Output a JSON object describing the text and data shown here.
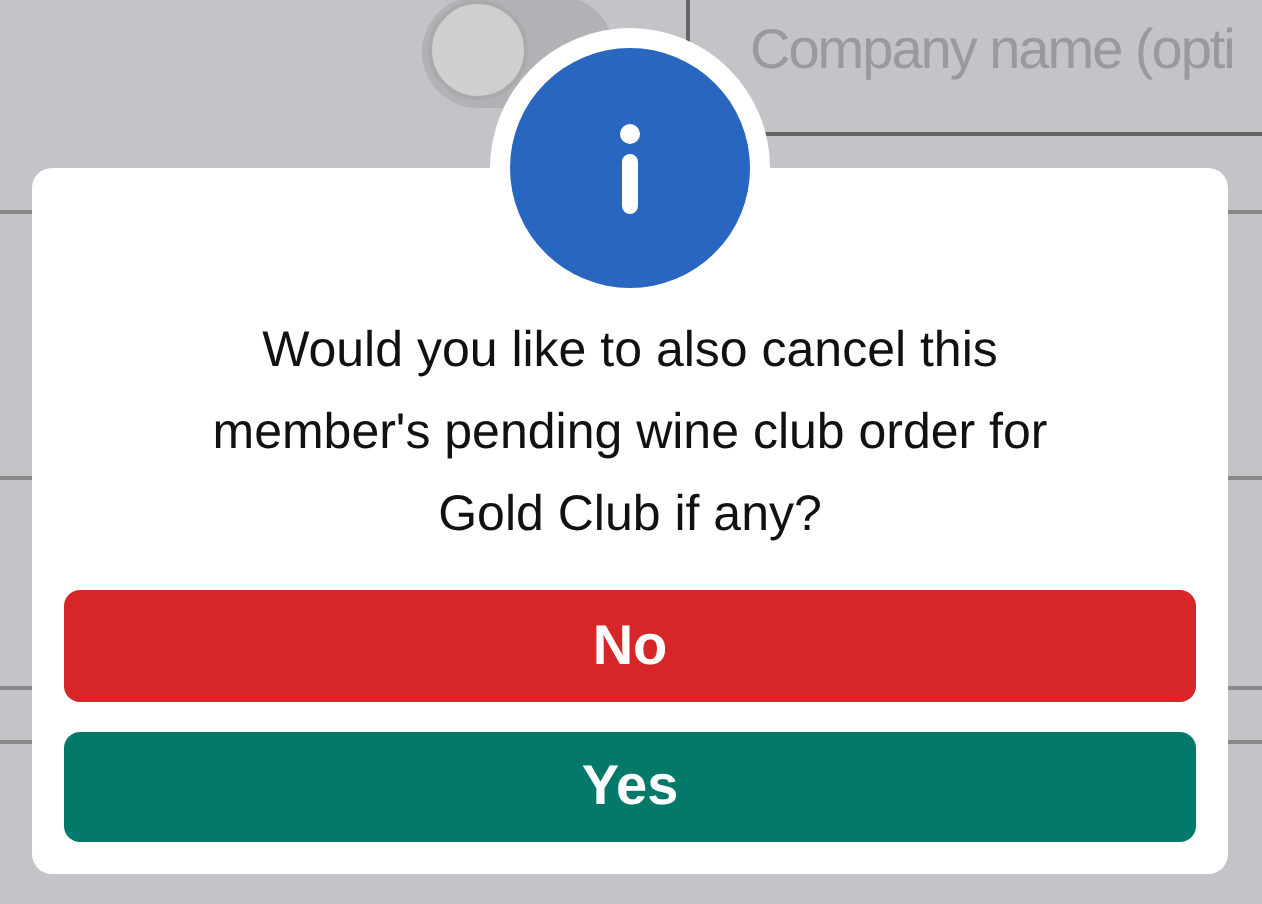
{
  "background": {
    "toggle": {
      "on": false
    },
    "company_field": {
      "placeholder": "Company name (opti"
    }
  },
  "dialog": {
    "message": "Would you like to also cancel this member's pending wine club order for Gold Club if any?",
    "buttons": [
      {
        "label": "No",
        "kind": "danger"
      },
      {
        "label": "Yes",
        "kind": "confirm"
      }
    ]
  }
}
